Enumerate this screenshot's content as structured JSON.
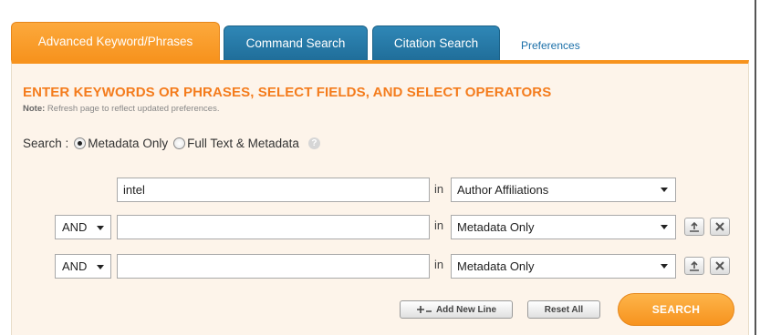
{
  "tabs": [
    {
      "label": "Advanced Keyword/Phrases",
      "active": true
    },
    {
      "label": "Command Search",
      "active": false
    },
    {
      "label": "Citation Search",
      "active": false
    }
  ],
  "preferences_link": "Preferences",
  "heading": "ENTER KEYWORDS OR PHRASES, SELECT FIELDS, AND SELECT OPERATORS",
  "note": {
    "prefix": "Note:",
    "text": " Refresh page to reflect updated preferences."
  },
  "search_scope": {
    "label": "Search :",
    "options": [
      {
        "label": "Metadata Only",
        "selected": true
      },
      {
        "label": "Full Text & Metadata",
        "selected": false
      }
    ],
    "help_icon": "question-icon"
  },
  "rows": [
    {
      "operator": null,
      "value": "intel",
      "in_label": "in",
      "field": "Author Affiliations",
      "removable": false
    },
    {
      "operator": "AND",
      "value": "",
      "in_label": "in",
      "field": "Metadata Only",
      "removable": true
    },
    {
      "operator": "AND",
      "value": "",
      "in_label": "in",
      "field": "Metadata Only",
      "removable": true
    }
  ],
  "buttons": {
    "add_new_line": "Add New Line",
    "reset_all": "Reset All",
    "search": "SEARCH"
  },
  "colors": {
    "accent_orange": "#f7931e",
    "heading_orange": "#f47c1d",
    "tab_blue": "#206e9a",
    "link_blue": "#1a6fa8",
    "panel_bg": "#fdf4ea"
  }
}
